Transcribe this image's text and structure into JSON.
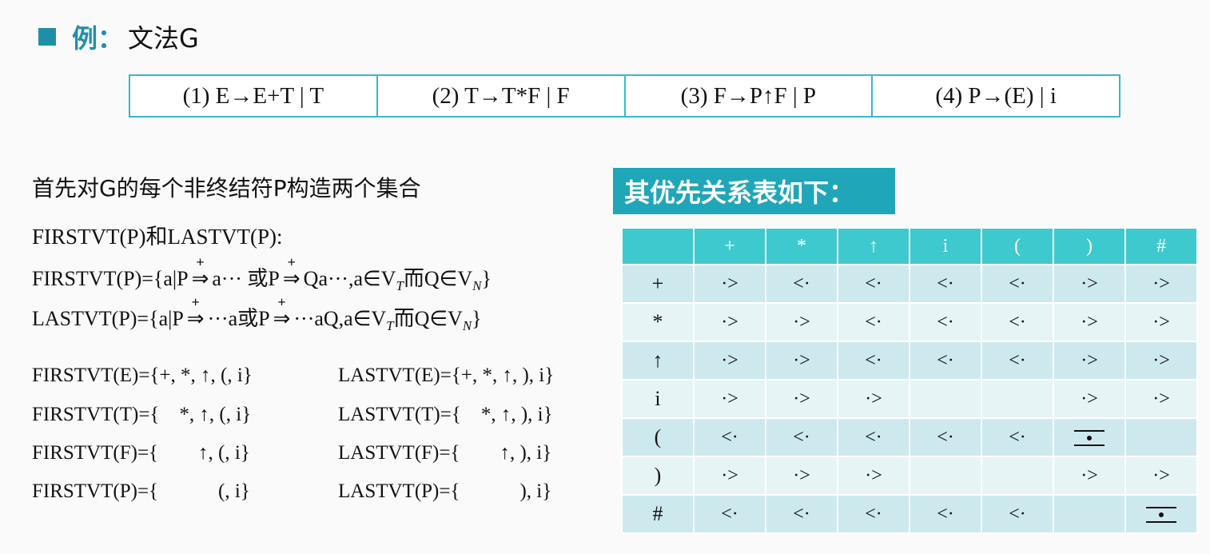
{
  "title": {
    "label": "例",
    "sep": "：",
    "text": "文法G"
  },
  "grammar": [
    "(1)  E→E+T | T",
    "(2)  T→T*F | F",
    "(3)  F→P↑F | P",
    "(4)  P→(E) | i"
  ],
  "intro": "首先对G的每个非终结符P构造两个集合",
  "def_heading": "FIRSTVT(P)和LASTVT(P):",
  "first_def": {
    "a": "FIRSTVT(P)={a|P",
    "b": "a··· 或P",
    "c": "Qa···,a∈V",
    "sub1": "T",
    "d": "而Q∈V",
    "sub2": "N",
    "e": "}"
  },
  "last_def": {
    "a": "LASTVT(P)={a|P",
    "b": "···a或P",
    "c": "···aQ,a∈V",
    "sub1": "T",
    "d": "而Q∈V",
    "sub2": "N",
    "e": "}"
  },
  "derive_plus": "+",
  "derive_arrow": "⇒",
  "firstvt": [
    "FIRSTVT(E)={+, *, ↑, (, i}",
    "FIRSTVT(T)={    *, ↑, (, i}",
    "FIRSTVT(F)={        ↑, (, i}",
    "FIRSTVT(P)={            (, i}"
  ],
  "lastvt": [
    "LASTVT(E)={+, *, ↑, ), i}",
    "LASTVT(T)={    *, ↑, ), i}",
    "LASTVT(F)={        ↑, ), i}",
    "LASTVT(P)={            ), i}"
  ],
  "table_title": "其优先关系表如下：",
  "table": {
    "columns": [
      "+",
      "*",
      "↑",
      "i",
      "(",
      ")",
      "#"
    ],
    "rows": [
      {
        "head": "+",
        "cells": [
          "·>",
          "<·",
          "<·",
          "<·",
          "<·",
          "·>",
          "·>"
        ]
      },
      {
        "head": "*",
        "cells": [
          "·>",
          "·>",
          "<·",
          "<·",
          "<·",
          "·>",
          "·>"
        ]
      },
      {
        "head": "↑",
        "cells": [
          "·>",
          "·>",
          "<·",
          "<·",
          "<·",
          "·>",
          "·>"
        ]
      },
      {
        "head": "i",
        "cells": [
          "·>",
          "·>",
          "·>",
          "",
          "",
          "·>",
          "·>"
        ]
      },
      {
        "head": "(",
        "cells": [
          "<·",
          "<·",
          "<·",
          "<·",
          "<·",
          "=",
          ""
        ]
      },
      {
        "head": ")",
        "cells": [
          "·>",
          "·>",
          "·>",
          "",
          "",
          "·>",
          "·>"
        ]
      },
      {
        "head": "#",
        "cells": [
          "<·",
          "<·",
          "<·",
          "<·",
          "<·",
          "",
          "="
        ]
      }
    ]
  }
}
